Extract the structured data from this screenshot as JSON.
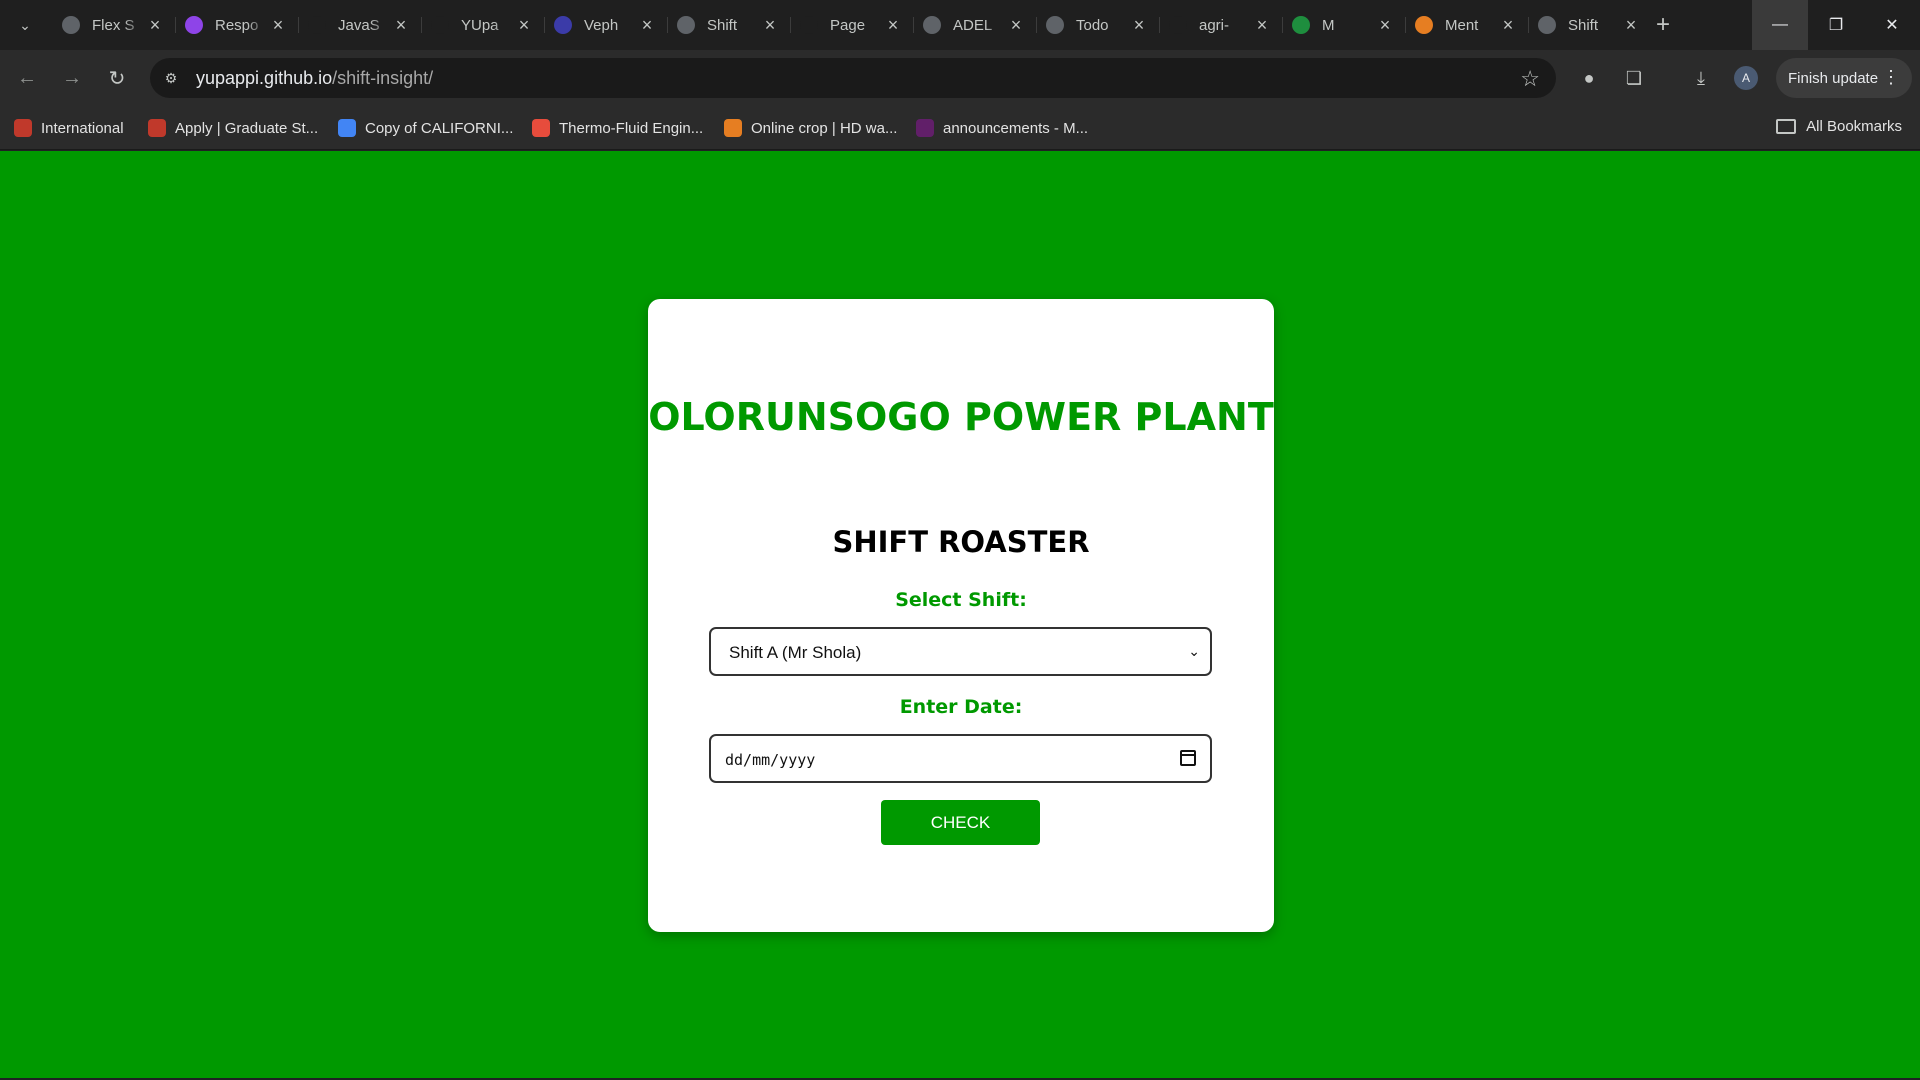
{
  "browser": {
    "tabs": [
      {
        "title": "Flex S",
        "favicon": "openai-icon",
        "color": "#5f6368"
      },
      {
        "title": "Respo",
        "favicon": "u-icon",
        "color": "#8e44e8"
      },
      {
        "title": "JavaS",
        "favicon": "m-icon",
        "color": "#1f1f1f"
      },
      {
        "title": "YUpa",
        "favicon": "github-icon",
        "color": "#1f1f1f"
      },
      {
        "title": "Veph",
        "favicon": "vephla-icon",
        "color": "#3b3ba8"
      },
      {
        "title": "Shift",
        "favicon": "globe-icon",
        "color": "#5f6368"
      },
      {
        "title": "Page",
        "favicon": "github-icon",
        "color": "#1f1f1f"
      },
      {
        "title": "ADEL",
        "favicon": "globe-icon",
        "color": "#5f6368"
      },
      {
        "title": "Todo",
        "favicon": "globe-icon",
        "color": "#5f6368"
      },
      {
        "title": "agri-",
        "favicon": "vercel-icon",
        "color": "#1f1f1f"
      },
      {
        "title": "M",
        "favicon": "meet-icon",
        "color": "#1e8e3e"
      },
      {
        "title": "Ment",
        "favicon": "layers-icon",
        "color": "#e67e22"
      },
      {
        "title": "Shift",
        "favicon": "globe-icon",
        "color": "#5f6368"
      }
    ],
    "url_host": "yupappi.github.io",
    "url_path": "/shift-insight/",
    "avatar_letter": "A",
    "finish_update": "Finish update",
    "bookmarks": [
      {
        "label": "International",
        "favicon": "dragon-icon",
        "color": "#c0392b"
      },
      {
        "label": "Apply | Graduate St...",
        "favicon": "university-icon",
        "color": "#c0392b"
      },
      {
        "label": "Copy of CALIFORNI...",
        "favicon": "docs-icon",
        "color": "#4285f4"
      },
      {
        "label": "Thermo-Fluid Engin...",
        "favicon": "calendar-icon",
        "color": "#e74c3c"
      },
      {
        "label": "Online crop | HD wa...",
        "favicon": "flame-icon",
        "color": "#e67e22"
      },
      {
        "label": "announcements - M...",
        "favicon": "slack-icon",
        "color": "#611f69"
      }
    ],
    "all_bookmarks": "All Bookmarks"
  },
  "page": {
    "background": "#009900",
    "title": "OLORUNSOGO POWER PLANT",
    "subtitle": "SHIFT ROASTER",
    "shift_label": "Select Shift:",
    "shift_selected": "Shift A (Mr Shola)",
    "date_label": "Enter Date:",
    "date_placeholder": "dd/mm/yyyy",
    "check_button": "CHECK"
  }
}
